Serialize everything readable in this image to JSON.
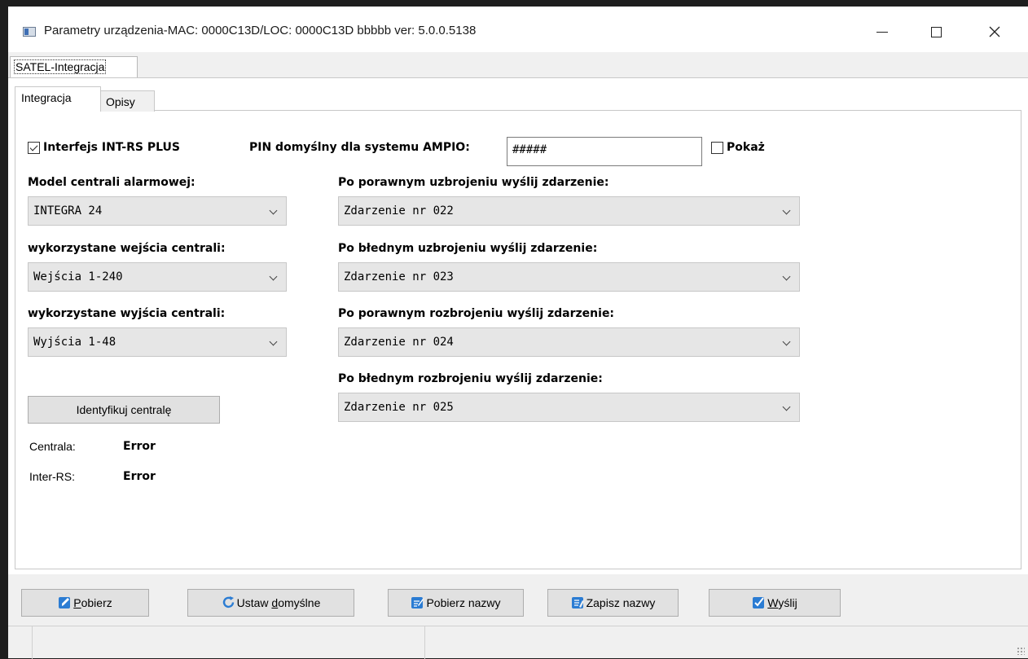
{
  "window": {
    "title": "Parametry urządzenia-MAC: 0000C13D/LOC: 0000C13D bbbbb ver: 5.0.0.5138"
  },
  "tabs": {
    "outer": "SATEL-Integracja",
    "inner": [
      "Integracja",
      "Opisy"
    ],
    "inner_active": "Integracja"
  },
  "form": {
    "interface_label": "Interfejs INT-RS PLUS",
    "interface_checked": true,
    "pin_label": "PIN domyślny dla systemu AMPIO:",
    "pin_value": "#####",
    "show_label": "Pokaż",
    "show_checked": false,
    "model_label": "Model centrali alarmowej:",
    "model_value": "INTEGRA 24",
    "inputs_label": "wykorzystane wejścia centrali:",
    "inputs_value": "Wejścia 1-240",
    "outputs_label": "wykorzystane wyjścia centrali:",
    "outputs_value": "Wyjścia 1-48",
    "arm_ok_label": "Po porawnym uzbrojeniu wyślij zdarzenie:",
    "arm_ok_value": "Zdarzenie nr 022",
    "arm_err_label": "Po błednym uzbrojeniu wyślij zdarzenie:",
    "arm_err_value": "Zdarzenie nr 023",
    "disarm_ok_label": "Po porawnym rozbrojeniu wyślij zdarzenie:",
    "disarm_ok_value": "Zdarzenie nr 024",
    "disarm_err_label": "Po błednym rozbrojeniu wyślij zdarzenie:",
    "disarm_err_value": "Zdarzenie nr 025",
    "identify_button": "Identyfikuj centralę",
    "central_label": "Centrala:",
    "central_status": "Error",
    "inter_rs_label": "Inter-RS:",
    "inter_rs_status": "Error"
  },
  "bottom_buttons": {
    "fetch": {
      "pre": "",
      "u": "P",
      "post": "obierz"
    },
    "defaults": {
      "pre": "Ustaw ",
      "u": "d",
      "post": "omyślne"
    },
    "fetch_names": "Pobierz nazwy",
    "save_names": "Zapisz nazwy",
    "send": {
      "pre": "",
      "u": "W",
      "post": "yślij"
    }
  },
  "colors": {
    "icon_blue": "#2b7cd3",
    "window_bg": "#f0f0f0",
    "combo_bg": "#e6e6e6"
  }
}
